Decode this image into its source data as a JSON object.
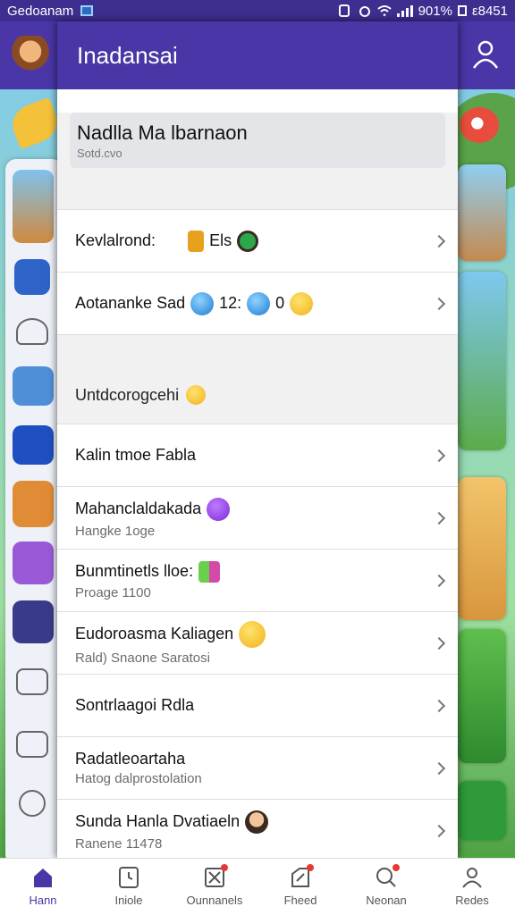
{
  "status_bar": {
    "carrier": "Gedoanam",
    "battery": "901%",
    "time": "ε8451"
  },
  "sheet": {
    "title": "Inadansai",
    "account": {
      "name": "Nadlla Ma lbarnaon",
      "sub": "Sotd.cvo"
    },
    "rows_top": [
      {
        "title": "Kevlalrond:",
        "inline": "Els"
      },
      {
        "title": "Aotananke Sad",
        "inline": "12:",
        "inline2": "0"
      }
    ],
    "section_title": "Untdcorogcehi",
    "rows": [
      {
        "title": "Kalin tmoe Fabla",
        "sub": ""
      },
      {
        "title": "Mahanclaldakada",
        "sub": "Hangke 1oge"
      },
      {
        "title": "Bunmtinetls lloe:",
        "sub": "Proage 1100"
      },
      {
        "title": "Eudoroasma Kaliagen",
        "sub": "Rald) Snaone Saratosi"
      },
      {
        "title": "Sontrlaagoi Rdla",
        "sub": ""
      },
      {
        "title": "Radatleoartaha",
        "sub": "Hatog dalprostolation"
      },
      {
        "title": "Sunda Hanla Dvatiaeln",
        "sub": "Ranene 11478"
      }
    ]
  },
  "bottom_nav": [
    {
      "label": "Hann",
      "icon": "home-icon",
      "active": true
    },
    {
      "label": "Iniole",
      "icon": "clock-icon",
      "active": false
    },
    {
      "label": "Ounnanels",
      "icon": "tools-icon",
      "active": false
    },
    {
      "label": "Fheed",
      "icon": "edit-icon",
      "active": false
    },
    {
      "label": "Neonan",
      "icon": "search-icon",
      "active": false
    },
    {
      "label": "Redes",
      "icon": "profile-icon",
      "active": false
    }
  ],
  "colors": {
    "primary": "#4a36a6",
    "status_bar": "#3e2e8f",
    "sheet_bg": "#ffffff",
    "section_bg": "#f1f1f2"
  }
}
